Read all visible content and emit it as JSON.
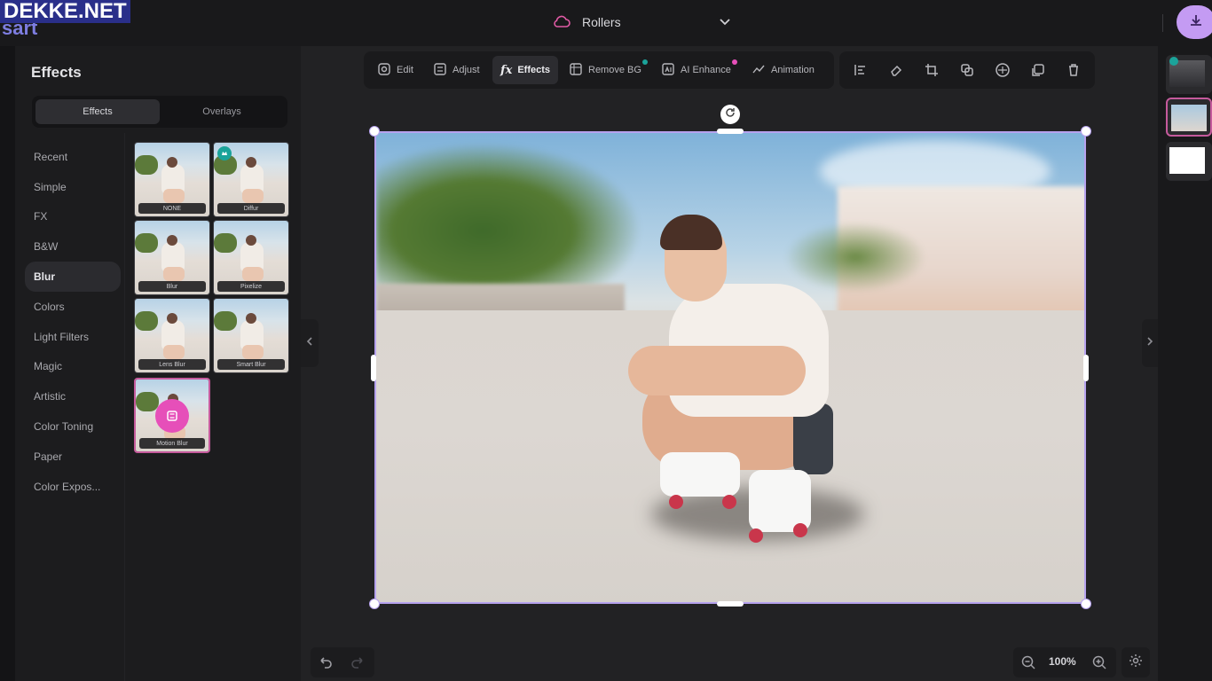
{
  "watermark": "DEKKE.NET",
  "logo_fragment": "sart",
  "document": {
    "title": "Rollers"
  },
  "left_panel": {
    "title": "Effects",
    "tabs": [
      {
        "label": "Effects",
        "active": true
      },
      {
        "label": "Overlays",
        "active": false
      }
    ],
    "categories": [
      {
        "label": "Recent"
      },
      {
        "label": "Simple"
      },
      {
        "label": "FX"
      },
      {
        "label": "B&W"
      },
      {
        "label": "Blur",
        "active": true
      },
      {
        "label": "Colors"
      },
      {
        "label": "Light Filters"
      },
      {
        "label": "Magic"
      },
      {
        "label": "Artistic"
      },
      {
        "label": "Color Toning"
      },
      {
        "label": "Paper"
      },
      {
        "label": "Color Expos..."
      }
    ],
    "effects": [
      {
        "label": "NONE"
      },
      {
        "label": "Diffur",
        "badge": true
      },
      {
        "label": "Blur"
      },
      {
        "label": "Pixelize"
      },
      {
        "label": "Lens Blur"
      },
      {
        "label": "Smart Blur"
      },
      {
        "label": "Motion Blur",
        "selected": true
      }
    ]
  },
  "toolbar": {
    "tools": [
      {
        "label": "Edit"
      },
      {
        "label": "Adjust"
      },
      {
        "label": "Effects",
        "active": true
      },
      {
        "label": "Remove BG",
        "dot_color": "#1ba39a"
      },
      {
        "label": "AI Enhance",
        "dot_color": "#e64fb9"
      },
      {
        "label": "Animation"
      }
    ],
    "actions": [
      "align-icon",
      "eraser-icon",
      "crop-icon",
      "layers-copy-icon",
      "flip-icon",
      "duplicate-icon",
      "trash-icon"
    ]
  },
  "zoom": {
    "level": "100%"
  },
  "colors": {
    "accent": "#c49bf3",
    "selection": "#b6a2ee",
    "highlight": "#e64fb9",
    "badge": "#1ba39a"
  }
}
